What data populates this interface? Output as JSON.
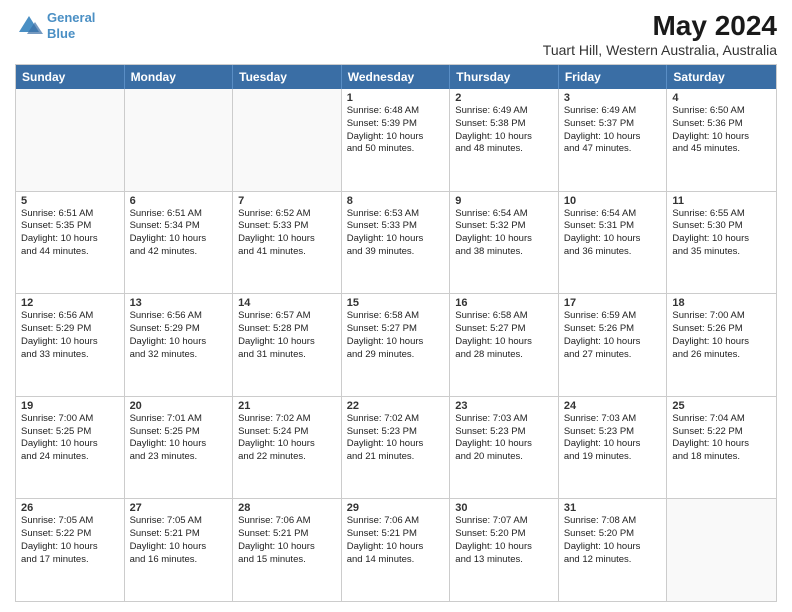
{
  "logo": {
    "line1": "General",
    "line2": "Blue"
  },
  "title": "May 2024",
  "subtitle": "Tuart Hill, Western Australia, Australia",
  "days": [
    "Sunday",
    "Monday",
    "Tuesday",
    "Wednesday",
    "Thursday",
    "Friday",
    "Saturday"
  ],
  "rows": [
    [
      {
        "num": "",
        "text": ""
      },
      {
        "num": "",
        "text": ""
      },
      {
        "num": "",
        "text": ""
      },
      {
        "num": "1",
        "text": "Sunrise: 6:48 AM\nSunset: 5:39 PM\nDaylight: 10 hours\nand 50 minutes."
      },
      {
        "num": "2",
        "text": "Sunrise: 6:49 AM\nSunset: 5:38 PM\nDaylight: 10 hours\nand 48 minutes."
      },
      {
        "num": "3",
        "text": "Sunrise: 6:49 AM\nSunset: 5:37 PM\nDaylight: 10 hours\nand 47 minutes."
      },
      {
        "num": "4",
        "text": "Sunrise: 6:50 AM\nSunset: 5:36 PM\nDaylight: 10 hours\nand 45 minutes."
      }
    ],
    [
      {
        "num": "5",
        "text": "Sunrise: 6:51 AM\nSunset: 5:35 PM\nDaylight: 10 hours\nand 44 minutes."
      },
      {
        "num": "6",
        "text": "Sunrise: 6:51 AM\nSunset: 5:34 PM\nDaylight: 10 hours\nand 42 minutes."
      },
      {
        "num": "7",
        "text": "Sunrise: 6:52 AM\nSunset: 5:33 PM\nDaylight: 10 hours\nand 41 minutes."
      },
      {
        "num": "8",
        "text": "Sunrise: 6:53 AM\nSunset: 5:33 PM\nDaylight: 10 hours\nand 39 minutes."
      },
      {
        "num": "9",
        "text": "Sunrise: 6:54 AM\nSunset: 5:32 PM\nDaylight: 10 hours\nand 38 minutes."
      },
      {
        "num": "10",
        "text": "Sunrise: 6:54 AM\nSunset: 5:31 PM\nDaylight: 10 hours\nand 36 minutes."
      },
      {
        "num": "11",
        "text": "Sunrise: 6:55 AM\nSunset: 5:30 PM\nDaylight: 10 hours\nand 35 minutes."
      }
    ],
    [
      {
        "num": "12",
        "text": "Sunrise: 6:56 AM\nSunset: 5:29 PM\nDaylight: 10 hours\nand 33 minutes."
      },
      {
        "num": "13",
        "text": "Sunrise: 6:56 AM\nSunset: 5:29 PM\nDaylight: 10 hours\nand 32 minutes."
      },
      {
        "num": "14",
        "text": "Sunrise: 6:57 AM\nSunset: 5:28 PM\nDaylight: 10 hours\nand 31 minutes."
      },
      {
        "num": "15",
        "text": "Sunrise: 6:58 AM\nSunset: 5:27 PM\nDaylight: 10 hours\nand 29 minutes."
      },
      {
        "num": "16",
        "text": "Sunrise: 6:58 AM\nSunset: 5:27 PM\nDaylight: 10 hours\nand 28 minutes."
      },
      {
        "num": "17",
        "text": "Sunrise: 6:59 AM\nSunset: 5:26 PM\nDaylight: 10 hours\nand 27 minutes."
      },
      {
        "num": "18",
        "text": "Sunrise: 7:00 AM\nSunset: 5:26 PM\nDaylight: 10 hours\nand 26 minutes."
      }
    ],
    [
      {
        "num": "19",
        "text": "Sunrise: 7:00 AM\nSunset: 5:25 PM\nDaylight: 10 hours\nand 24 minutes."
      },
      {
        "num": "20",
        "text": "Sunrise: 7:01 AM\nSunset: 5:25 PM\nDaylight: 10 hours\nand 23 minutes."
      },
      {
        "num": "21",
        "text": "Sunrise: 7:02 AM\nSunset: 5:24 PM\nDaylight: 10 hours\nand 22 minutes."
      },
      {
        "num": "22",
        "text": "Sunrise: 7:02 AM\nSunset: 5:23 PM\nDaylight: 10 hours\nand 21 minutes."
      },
      {
        "num": "23",
        "text": "Sunrise: 7:03 AM\nSunset: 5:23 PM\nDaylight: 10 hours\nand 20 minutes."
      },
      {
        "num": "24",
        "text": "Sunrise: 7:03 AM\nSunset: 5:23 PM\nDaylight: 10 hours\nand 19 minutes."
      },
      {
        "num": "25",
        "text": "Sunrise: 7:04 AM\nSunset: 5:22 PM\nDaylight: 10 hours\nand 18 minutes."
      }
    ],
    [
      {
        "num": "26",
        "text": "Sunrise: 7:05 AM\nSunset: 5:22 PM\nDaylight: 10 hours\nand 17 minutes."
      },
      {
        "num": "27",
        "text": "Sunrise: 7:05 AM\nSunset: 5:21 PM\nDaylight: 10 hours\nand 16 minutes."
      },
      {
        "num": "28",
        "text": "Sunrise: 7:06 AM\nSunset: 5:21 PM\nDaylight: 10 hours\nand 15 minutes."
      },
      {
        "num": "29",
        "text": "Sunrise: 7:06 AM\nSunset: 5:21 PM\nDaylight: 10 hours\nand 14 minutes."
      },
      {
        "num": "30",
        "text": "Sunrise: 7:07 AM\nSunset: 5:20 PM\nDaylight: 10 hours\nand 13 minutes."
      },
      {
        "num": "31",
        "text": "Sunrise: 7:08 AM\nSunset: 5:20 PM\nDaylight: 10 hours\nand 12 minutes."
      },
      {
        "num": "",
        "text": ""
      }
    ]
  ]
}
